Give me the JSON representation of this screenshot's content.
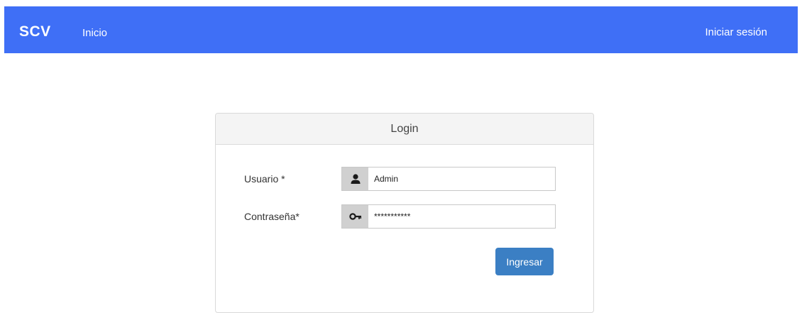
{
  "navbar": {
    "brand": "SCV",
    "home": "Inicio",
    "login": "Iniciar sesión"
  },
  "card": {
    "title": "Login",
    "username_label": "Usuario *",
    "username_value": "Admin",
    "password_label": "Contraseña*",
    "password_value": "***********",
    "submit_label": "Ingresar"
  },
  "icons": {
    "user": "user-icon",
    "key": "key-icon"
  },
  "colors": {
    "navbar": "#3f6ff6",
    "button": "#3b7fc4",
    "addon": "#d0d0d0"
  }
}
